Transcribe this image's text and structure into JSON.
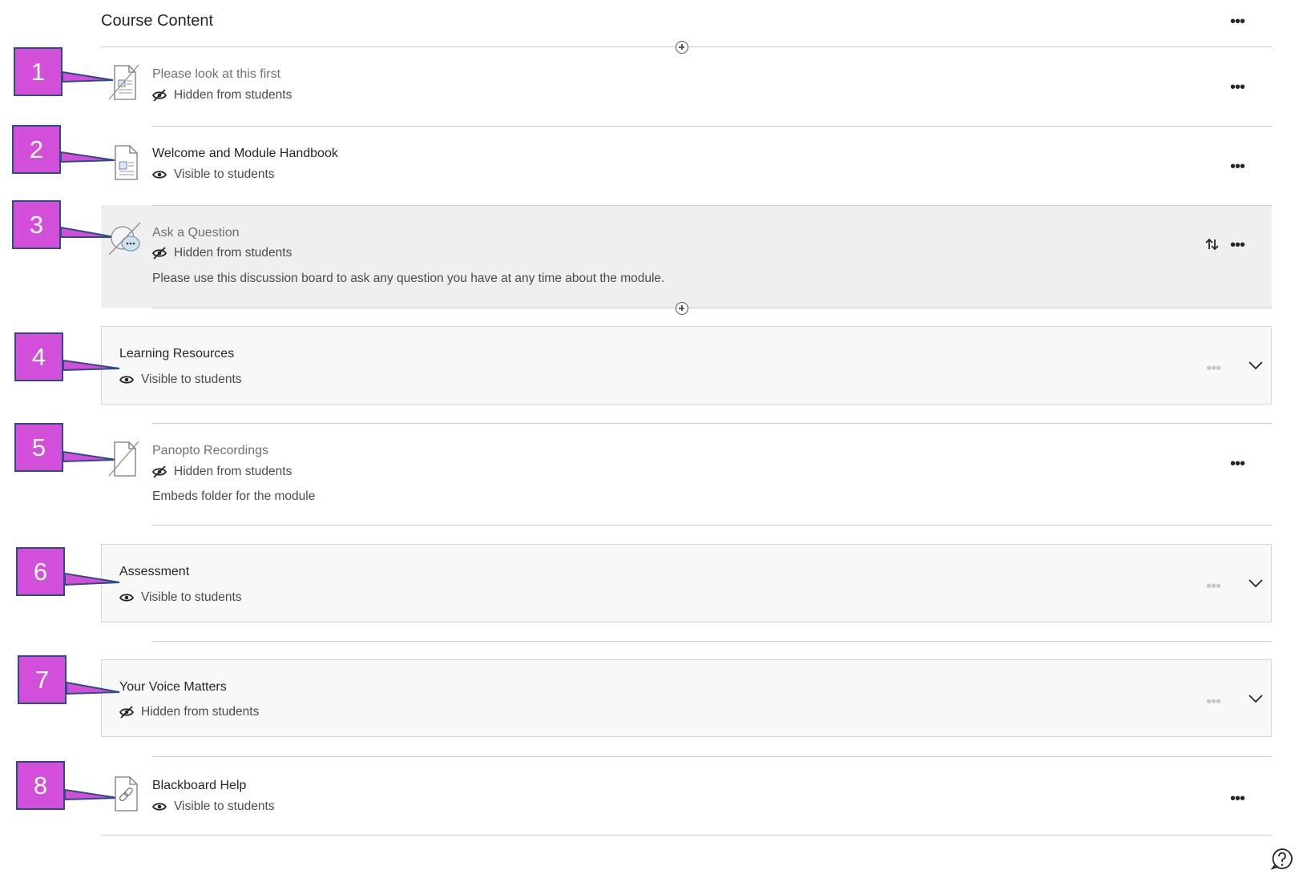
{
  "header": {
    "title": "Course Content"
  },
  "items": [
    {
      "num": "1",
      "title": "Please look at this first",
      "status": "Hidden from students",
      "visible": false,
      "icon": "hidden-document-icon"
    },
    {
      "num": "2",
      "title": "Welcome and Module Handbook",
      "status": "Visible to students",
      "visible": true,
      "icon": "document-icon"
    },
    {
      "num": "3",
      "title": "Ask a Question",
      "status": "Hidden from students",
      "visible": false,
      "icon": "hidden-discussion-icon",
      "description": "Please use this discussion board to ask any question you have at any time about the module."
    },
    {
      "num": "4",
      "title": "Learning Resources",
      "status": "Visible to students",
      "visible": true,
      "type": "folder"
    },
    {
      "num": "5",
      "title": "Panopto Recordings",
      "status": "Hidden from students",
      "visible": false,
      "icon": "hidden-blank-document-icon",
      "description": "Embeds folder for the module"
    },
    {
      "num": "6",
      "title": "Assessment",
      "status": "Visible to students",
      "visible": true,
      "type": "folder"
    },
    {
      "num": "7",
      "title": "Your Voice Matters",
      "status": "Hidden from students",
      "visible": false,
      "type": "folder"
    },
    {
      "num": "8",
      "title": "Blackboard Help",
      "status": "Visible to students",
      "visible": true,
      "icon": "link-document-icon"
    }
  ],
  "colors": {
    "callout_fill": "#d24fd9",
    "callout_border": "#2e4a87",
    "text": "#262626",
    "muted": "#707070"
  }
}
